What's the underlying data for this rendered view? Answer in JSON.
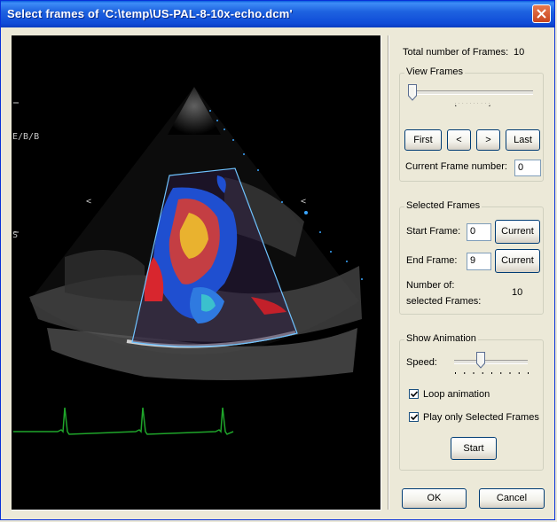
{
  "window": {
    "title": "Select frames of  'C:\\temp\\US-PAL-8-10x-echo.dcm'"
  },
  "viewer": {
    "overlay_label_top": "E/B/B",
    "marker_left": "<",
    "marker_right": "<",
    "mark_s": "S"
  },
  "info": {
    "total_frames_label": "Total number of Frames:",
    "total_frames_value": "10"
  },
  "view_frames": {
    "legend": "View Frames",
    "slider_position": 0,
    "first_label": "First",
    "prev_label": "<",
    "next_label": ">",
    "last_label": "Last",
    "current_frame_label": "Current Frame number:",
    "current_frame_value": "0"
  },
  "selected_frames": {
    "legend": "Selected Frames",
    "start_label": "Start Frame:",
    "start_value": "0",
    "start_current_label": "Current",
    "end_label": "End Frame:",
    "end_value": "9",
    "end_current_label": "Current",
    "count_label_line1": "Number of:",
    "count_label_line2": "selected Frames:",
    "count_value": "10"
  },
  "animation": {
    "legend": "Show Animation",
    "speed_label": "Speed:",
    "speed_position": 0.35,
    "loop_label": "Loop animation",
    "loop_checked": true,
    "selected_only_label": "Play only Selected Frames",
    "selected_only_checked": true,
    "start_label": "Start"
  },
  "footer": {
    "ok_label": "OK",
    "cancel_label": "Cancel"
  },
  "colors": {
    "titlebar": "#1e63e0",
    "dialog_bg": "#ece9d8",
    "ecg_trace": "#1fa52a",
    "sector_outline": "#6fc3ff"
  },
  "icons": {
    "close": "close-icon",
    "checkmark": "checkmark-icon",
    "slider_thumb": "slider-thumb-icon"
  }
}
